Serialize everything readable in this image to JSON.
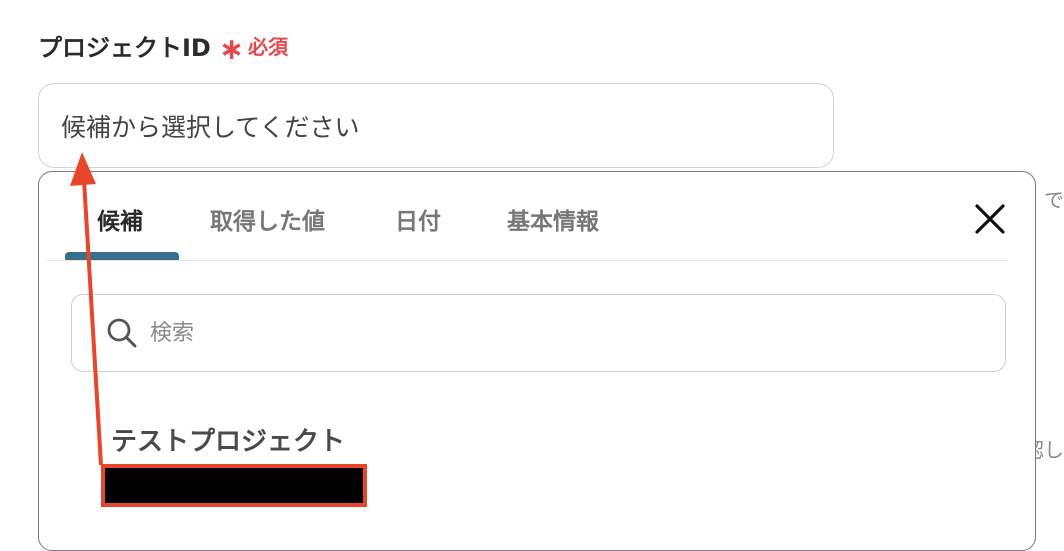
{
  "field": {
    "label": "プロジェクトID",
    "required_mark": "∗",
    "required_text": "必須"
  },
  "select": {
    "placeholder": "候補から選択してください"
  },
  "side_text": {
    "line1": "で",
    "line2": "認し"
  },
  "dropdown": {
    "tabs": [
      {
        "label": "候補",
        "active": true
      },
      {
        "label": "取得した値",
        "active": false
      },
      {
        "label": "日付",
        "active": false
      },
      {
        "label": "基本情報",
        "active": false
      }
    ],
    "search_placeholder": "検索",
    "options": [
      {
        "label": "テストプロジェクト"
      }
    ]
  },
  "icons": [
    "search-icon",
    "close-icon"
  ],
  "colors": {
    "required": "#e5484d",
    "tab_underline": "#3a6f8c",
    "annotation": "#e8462a"
  }
}
